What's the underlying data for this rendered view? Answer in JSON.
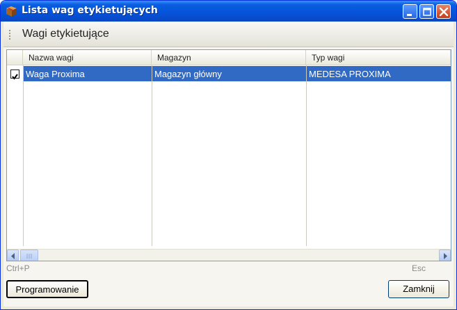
{
  "window": {
    "title": "Lista wag etykietujących",
    "icon": "box-icon"
  },
  "title_buttons": {
    "minimize": "minimize-icon",
    "maximize": "maximize-icon",
    "close": "close-icon"
  },
  "header": {
    "title": "Wagi etykietujące"
  },
  "table": {
    "columns": [
      "Nazwa wagi",
      "Magazyn",
      "Typ wagi"
    ],
    "rows": [
      {
        "checked": true,
        "name": "Waga Proxima",
        "warehouse": "Magazyn główny",
        "type": "MEDESA PROXIMA"
      }
    ]
  },
  "footer": {
    "left_shortcut": "Ctrl+P",
    "left_button": "Programowanie",
    "right_shortcut": "Esc",
    "right_button": "Zamknij"
  },
  "colors": {
    "title_bar": "#0553d8",
    "selection": "#316ac5",
    "close_button": "#c53b16"
  }
}
